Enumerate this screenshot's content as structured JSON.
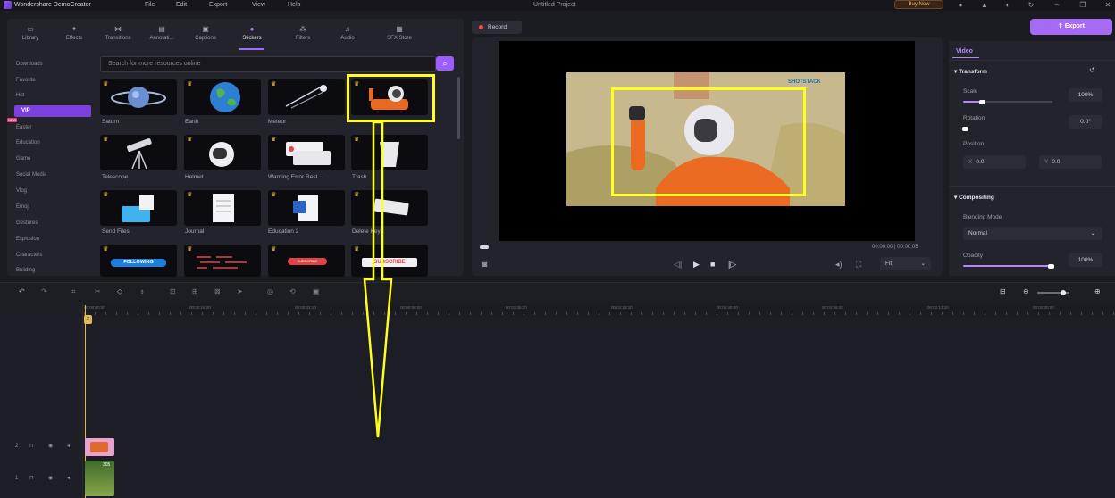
{
  "titlebar": {
    "app_name": "Wondershare DemoCreator",
    "menu": [
      "File",
      "Edit",
      "Export",
      "View",
      "Help"
    ],
    "project_title": "Untitled Project",
    "buy_now": "Buy Now"
  },
  "tabs": [
    {
      "label": "Library",
      "icon": "library-icon"
    },
    {
      "label": "Effects",
      "icon": "effects-icon"
    },
    {
      "label": "Transitions",
      "icon": "transitions-icon"
    },
    {
      "label": "Annotati...",
      "icon": "annotation-icon"
    },
    {
      "label": "Captions",
      "icon": "captions-icon"
    },
    {
      "label": "Stickers",
      "icon": "stickers-icon",
      "active": true
    },
    {
      "label": "Filters",
      "icon": "filters-icon"
    },
    {
      "label": "Audio",
      "icon": "audio-icon"
    },
    {
      "label": "SFX Store",
      "icon": "sfx-store-icon"
    }
  ],
  "categories": [
    "Downloads",
    "Favorite",
    "Hot",
    "VIP",
    "Easter",
    "Education",
    "Game",
    "Social Media",
    "Vlog",
    "Emoji",
    "Gestures",
    "Explosion",
    "Characters",
    "Building"
  ],
  "active_category": "VIP",
  "new_badge": "NEW",
  "search": {
    "placeholder": "Search for more resources online"
  },
  "stickers": [
    [
      "Saturn",
      "Earth",
      "Meteor",
      ""
    ],
    [
      "Telescope",
      "Helmet",
      "Warning Error Rest...",
      "Trash"
    ],
    [
      "Send Files",
      "Journal",
      "Education 2",
      "Delete Key"
    ],
    [
      "",
      "",
      "",
      ""
    ]
  ],
  "sticker_texts": {
    "following": "FOLLOWING",
    "subscribe_small": "SUBSCRIBE",
    "subscribe": "SUBSCRIBE"
  },
  "preview": {
    "record_label": "Record",
    "watermark": "SHOTSTACK",
    "time": "00:00:00 | 00:00:05",
    "fit": "Fit"
  },
  "export_label": "Export",
  "right_panel": {
    "tab": "Video",
    "transform": "Transform",
    "scale_label": "Scale",
    "scale_value": "100%",
    "rotation_label": "Rotation",
    "rotation_value": "0.0°",
    "position_label": "Position",
    "pos_x_key": "X",
    "pos_x": "0.0",
    "pos_y_key": "Y",
    "pos_y": "0.0",
    "compositing": "Compositing",
    "blending_label": "Blending Mode",
    "blending_value": "Normal",
    "opacity_label": "Opacity",
    "opacity_value": "100%"
  },
  "timeline": {
    "ruler": [
      "00:00:00:00",
      "00:00:16:20",
      "00:00:33:10",
      "00:00:50:00",
      "00:01:06:20",
      "00:01:23:10",
      "00:01:40:00",
      "00:01:56:20",
      "00:02:13:10",
      "00:02:30:00"
    ],
    "track_numbers": [
      "2",
      "1"
    ],
    "clip2_label": "305"
  },
  "colors": {
    "accent": "#a56bf5",
    "highlight": "#ffff1e",
    "playhead": "#e5b94c"
  }
}
